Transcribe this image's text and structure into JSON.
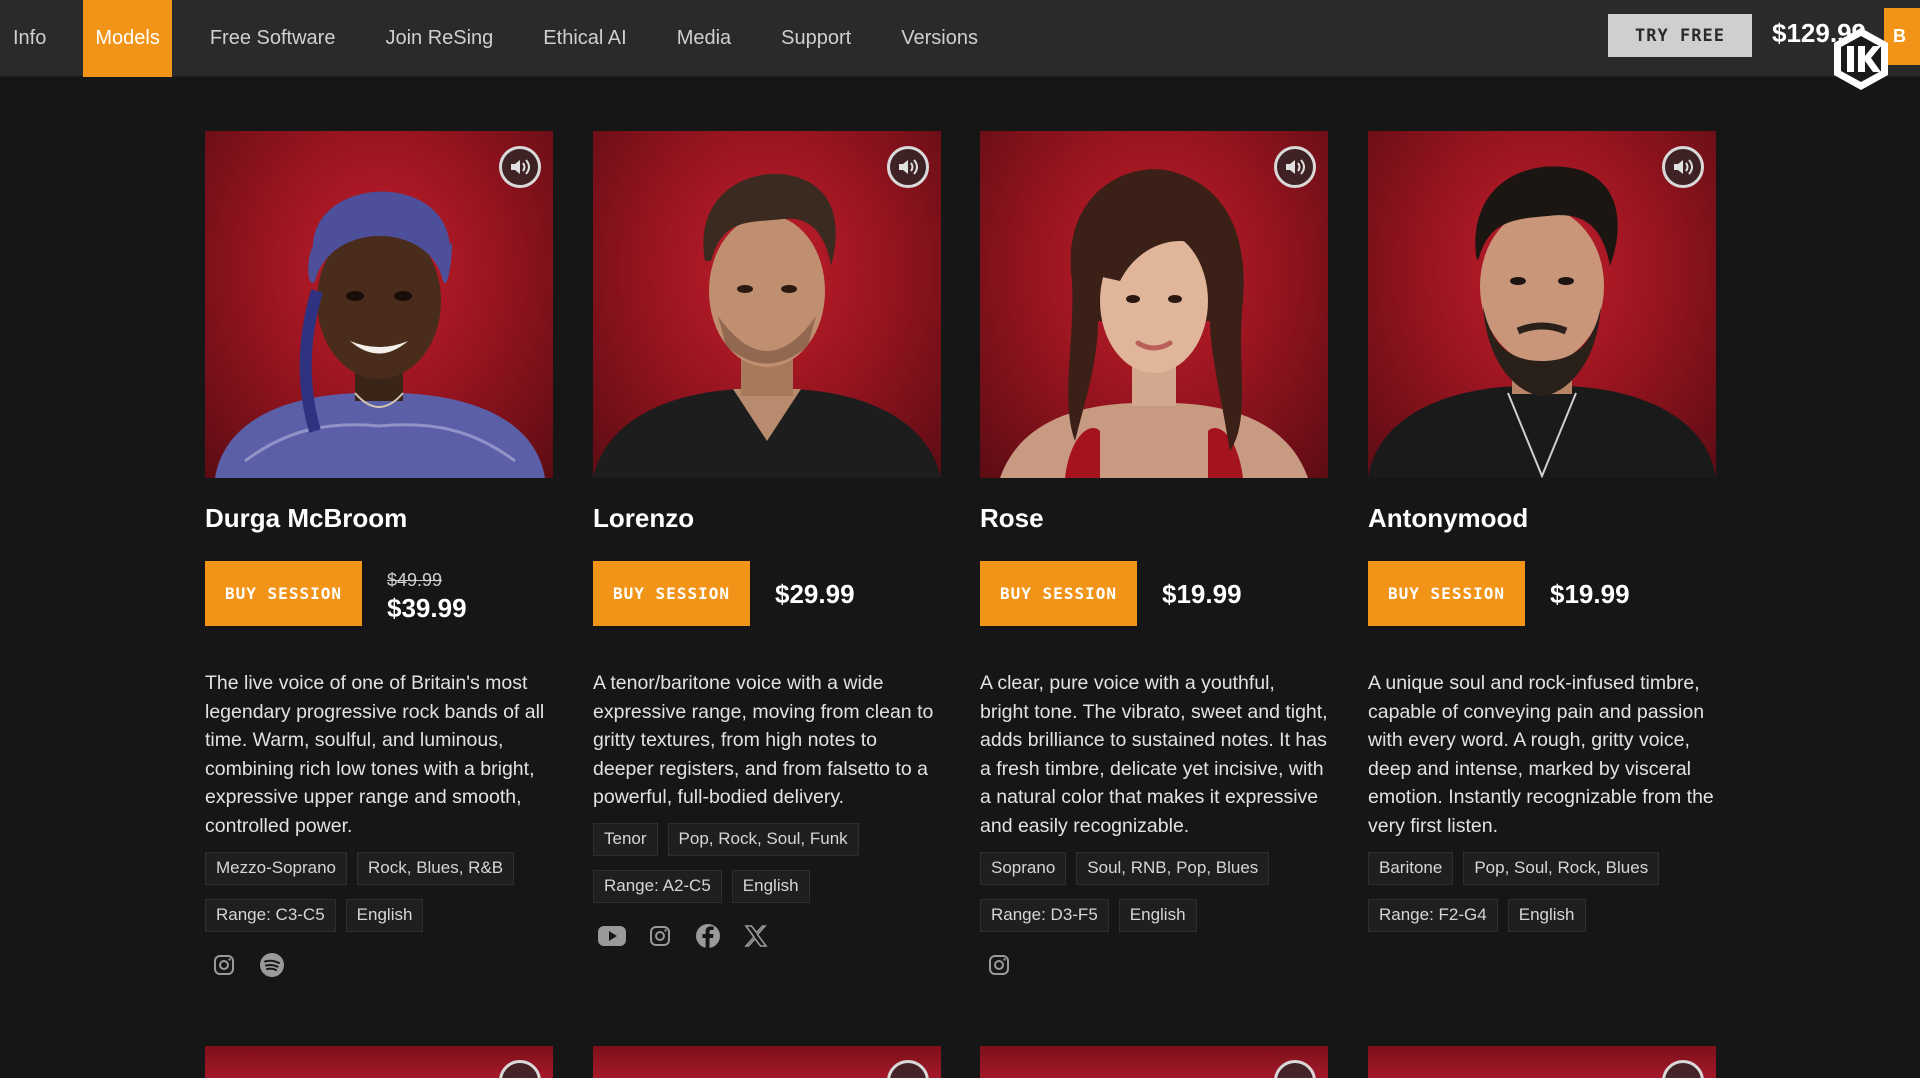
{
  "nav": {
    "links": [
      "Info",
      "Models",
      "Free Software",
      "Join ReSing",
      "Ethical AI",
      "Media",
      "Support",
      "Versions"
    ],
    "active": "Models",
    "try_free": "TRY FREE",
    "price": "$129.99",
    "orange_label": "B"
  },
  "colors": {
    "accent": "#f29418",
    "background": "#161616",
    "nav": "#2a2a2a",
    "photo_red": "#b01a26"
  },
  "cards": [
    {
      "name": "Durga McBroom",
      "buy": "BUY SESSION",
      "old_price": "$49.99",
      "price": "$39.99",
      "description": "The live voice of one of Britain's most legendary progressive rock bands of all time. Warm, soulful, and luminous, combining rich low tones with a bright, expressive upper range and smooth, controlled power.",
      "tags": [
        "Mezzo-Soprano",
        "Rock, Blues, R&B",
        "Range: C3-C5",
        "English"
      ],
      "socials": [
        "instagram-icon",
        "spotify-icon"
      ]
    },
    {
      "name": "Lorenzo",
      "buy": "BUY SESSION",
      "price": "$29.99",
      "description": "A tenor/baritone voice with a wide expressive range, moving from clean to gritty textures, from high notes to deeper registers, and from falsetto to a powerful, full-bodied delivery.",
      "tags": [
        "Tenor",
        "Pop, Rock, Soul, Funk",
        "Range: A2-C5",
        "English"
      ],
      "socials": [
        "youtube-icon",
        "instagram-icon",
        "facebook-icon",
        "x-icon"
      ]
    },
    {
      "name": "Rose",
      "buy": "BUY SESSION",
      "price": "$19.99",
      "description": "A clear, pure voice with a youthful, bright tone. The vibrato, sweet and tight, adds brilliance to sustained notes. It has a fresh timbre, delicate yet incisive, with a natural color that makes it expressive and easily recognizable.",
      "tags": [
        "Soprano",
        "Soul, RNB, Pop, Blues",
        "Range: D3-F5",
        "English"
      ],
      "socials": [
        "instagram-icon"
      ]
    },
    {
      "name": "Antonymood",
      "buy": "BUY SESSION",
      "price": "$19.99",
      "description": "A unique soul and rock-infused timbre, capable of conveying pain and passion with every word. A rough, gritty voice, deep and intense, marked by visceral emotion. Instantly recognizable from the very first listen.",
      "tags": [
        "Baritone",
        "Pop, Soul, Rock, Blues",
        "Range: F2-G4",
        "English"
      ],
      "socials": []
    }
  ]
}
